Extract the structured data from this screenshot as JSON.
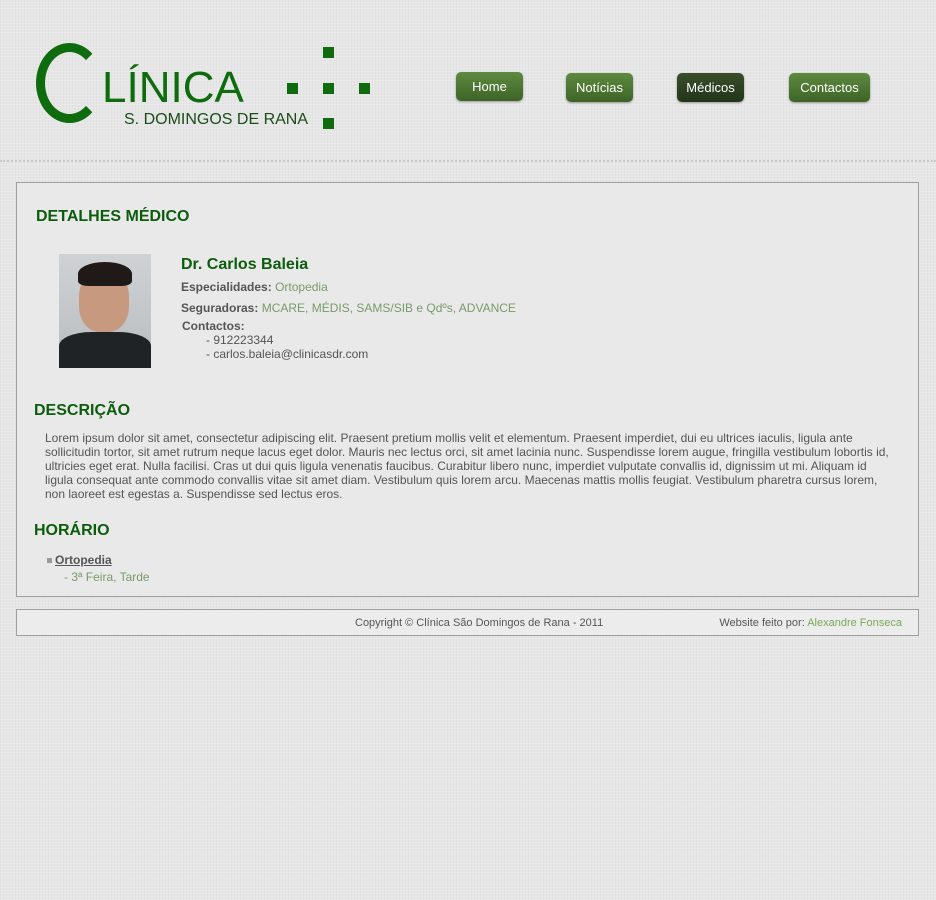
{
  "brand": {
    "title": "LÍNICA",
    "subtitle": "S. DOMINGOS DE RANA"
  },
  "nav": {
    "home": "Home",
    "noticias": "Notícias",
    "medicos": "Médicos",
    "contactos": "Contactos",
    "active": "Médicos"
  },
  "page": {
    "section_title": "DETALHES MÉDICO",
    "doctor": {
      "name": "Dr. Carlos Baleia",
      "specialties_label": "Especialidades:",
      "specialties": "Ortopedia",
      "insurers_label": "Seguradoras:",
      "insurers": "MCARE, MÉDIS, SAMS/SIB e Qdºs, ADVANCE",
      "contacts_label": "Contactos:",
      "phone": "- 912223344",
      "email": "- carlos.baleia@clinicasdr.com"
    },
    "description_title": "DESCRIÇÃO",
    "description": "Lorem ipsum dolor sit amet, consectetur adipiscing elit. Praesent pretium mollis velit et elementum. Praesent imperdiet, dui eu ultrices iaculis, ligula ante sollicitudin tortor, sit amet rutrum neque lacus eget dolor. Mauris nec lectus orci, sit amet lacinia nunc. Suspendisse lorem augue, fringilla vestibulum lobortis id, ultricies eget erat. Nulla facilisi. Cras ut dui quis ligula venenatis faucibus. Curabitur libero nunc, imperdiet vulputate convallis id, dignissim ut mi. Aliquam id ligula consequat ante commodo convallis vitae sit amet diam. Vestibulum quis lorem arcu. Maecenas mattis mollis feugiat. Vestibulum pharetra cursus lorem, non laoreet est egestas a. Suspendisse sed lectus eros.",
    "schedule_title": "HORÁRIO",
    "schedule": {
      "specialty": "Ortopedia",
      "time": "- 3ª Feira, Tarde"
    }
  },
  "footer": {
    "copyright": "Copyright © Clínica São Domingos de Rana - 2011",
    "credit_label": "Website feito por:",
    "credit_author": "Alexandre Fonseca"
  },
  "colors": {
    "brand_green": "#0e6b0e",
    "nav_green": "#4f7a33",
    "nav_active": "#2e4223",
    "link_green": "#7a9a6a"
  }
}
